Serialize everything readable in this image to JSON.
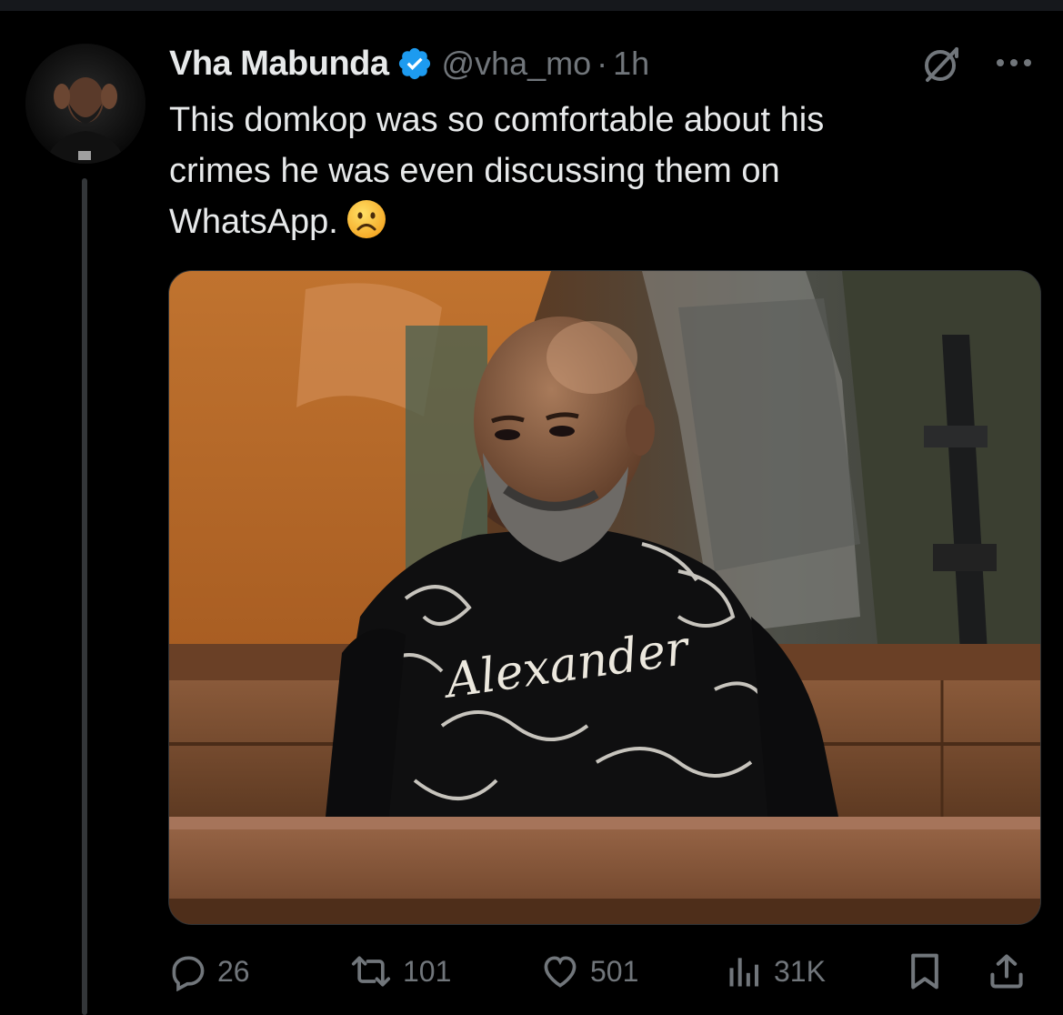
{
  "tweet": {
    "author": {
      "display_name": "Vha Mabunda",
      "handle": "@vha_mo",
      "verified": true
    },
    "separator": "·",
    "time": "1h",
    "text_lines": [
      "This domkop was so comfortable about his",
      "crimes he was even discussing them on",
      "WhatsApp."
    ],
    "emoji": "frowning-face",
    "media": {
      "sweater_text": "Alexander"
    },
    "actions": {
      "replies": "26",
      "reposts": "101",
      "likes": "501",
      "views": "31K"
    }
  },
  "colors": {
    "background": "#000000",
    "text_primary": "#e7e9ea",
    "text_secondary": "#71767b",
    "verified_blue": "#1d9bf0",
    "thread_line": "#333639"
  }
}
